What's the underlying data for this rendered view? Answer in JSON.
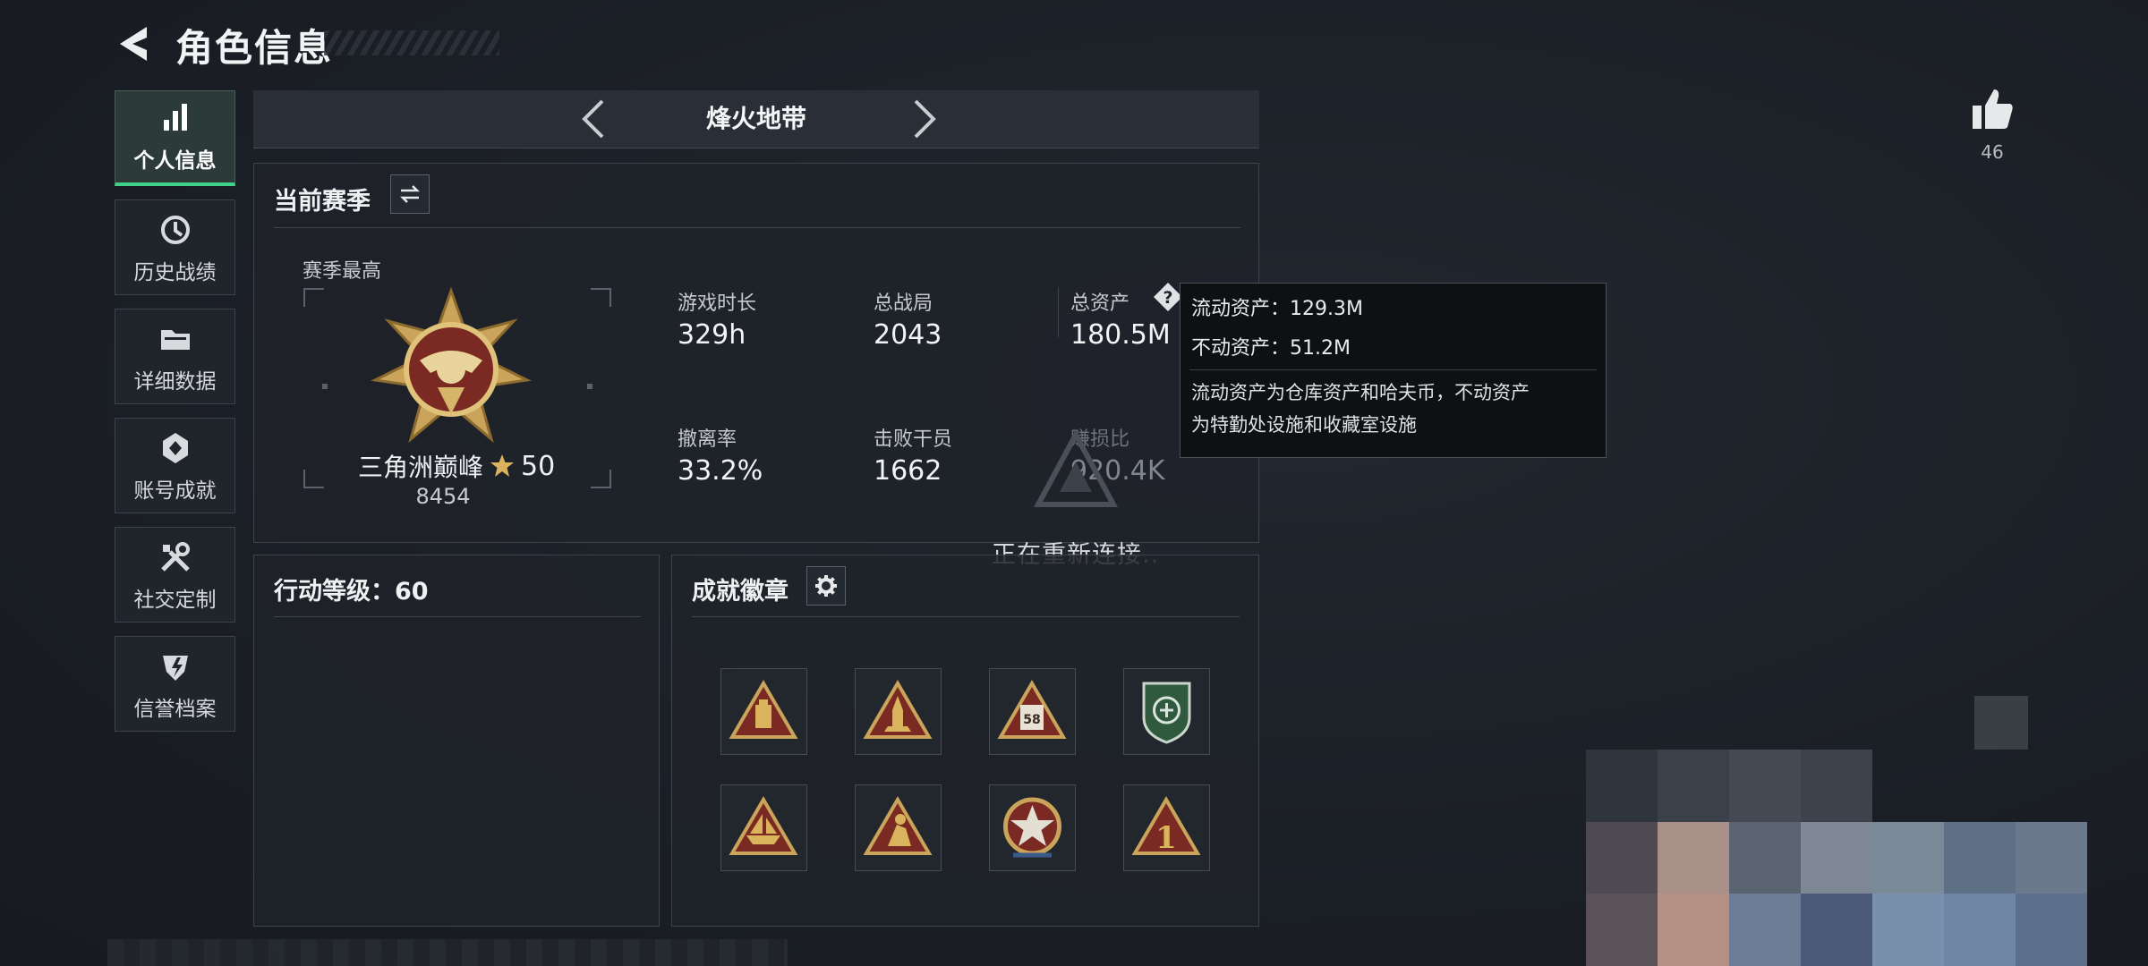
{
  "header": {
    "title": "角色信息"
  },
  "sidebar": {
    "items": [
      {
        "label": "个人信息",
        "icon": "bar-chart-icon",
        "active": true
      },
      {
        "label": "历史战绩",
        "icon": "history-icon",
        "active": false
      },
      {
        "label": "详细数据",
        "icon": "folder-icon",
        "active": false
      },
      {
        "label": "账号成就",
        "icon": "achievement-icon",
        "active": false
      },
      {
        "label": "社交定制",
        "icon": "tools-icon",
        "active": false
      },
      {
        "label": "信誉档案",
        "icon": "credit-shield-icon",
        "active": false
      }
    ]
  },
  "mode": {
    "title": "烽火地带"
  },
  "season": {
    "heading": "当前赛季",
    "best_label": "赛季最高",
    "rank_name": "三角洲巅峰",
    "rank_stars": "50",
    "rank_score": "8454",
    "stats": [
      {
        "label": "游戏时长",
        "value": "329h"
      },
      {
        "label": "总战局",
        "value": "2043"
      },
      {
        "label": "总资产",
        "value": "180.5M"
      },
      {
        "label": "撤离率",
        "value": "33.2%"
      },
      {
        "label": "击败干员",
        "value": "1662"
      },
      {
        "label": "赚损比",
        "value": "920.4K"
      }
    ]
  },
  "tooltip": {
    "liquid": "流动资产：129.3M",
    "fixed": "不动资产：51.2M",
    "desc_line1": "流动资产为仓库资产和哈夫币，不动资产",
    "desc_line2": "为特勤处设施和收藏室设施"
  },
  "status": {
    "reconnecting": "正在重新连接.."
  },
  "level": {
    "heading": "行动等级：60"
  },
  "badges": {
    "heading": "成就徽章",
    "items": [
      "treasure-badge-icon",
      "rocket-badge-icon",
      "number-58-badge-icon",
      "green-shield-badge-icon",
      "boat-badge-icon",
      "soldier-badge-icon",
      "star-medal-badge-icon",
      "number-1-badge-icon"
    ]
  },
  "likes": {
    "count": "46"
  },
  "colors": {
    "accent": "#3fd38a",
    "background": "#1b1f26",
    "gold": "#c9a45a",
    "badge_red": "#7a2a22"
  }
}
